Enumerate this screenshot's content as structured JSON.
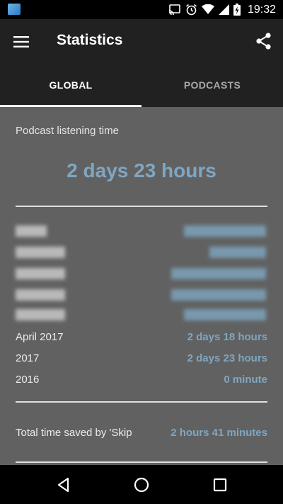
{
  "status_bar": {
    "time": "19:32",
    "icons": [
      "cast-icon",
      "alarm-icon",
      "wifi-icon",
      "signal-icon",
      "battery-charging-icon"
    ]
  },
  "app_bar": {
    "title": "Statistics",
    "menu_icon": "menu-icon",
    "share_icon": "share-icon"
  },
  "tabs": [
    {
      "label": "GLOBAL",
      "selected": true
    },
    {
      "label": "PODCASTS",
      "selected": false
    }
  ],
  "summary": {
    "label": "Podcast listening time",
    "total": "2 days 23 hours"
  },
  "stats": [
    {
      "label": "April 2017",
      "value": "2 days 18 hours"
    },
    {
      "label": "2017",
      "value": "2 days 23 hours"
    },
    {
      "label": "2016",
      "value": "0 minute"
    }
  ],
  "skip": {
    "label": "Total time saved by 'Skip",
    "value": "2 hours 41 minutes"
  },
  "nav_bar": {
    "icons": [
      "back-icon",
      "home-icon",
      "recents-icon"
    ]
  },
  "colors": {
    "accent": "#7fa6c2",
    "content_bg": "#616161",
    "bar_bg": "#212121"
  }
}
